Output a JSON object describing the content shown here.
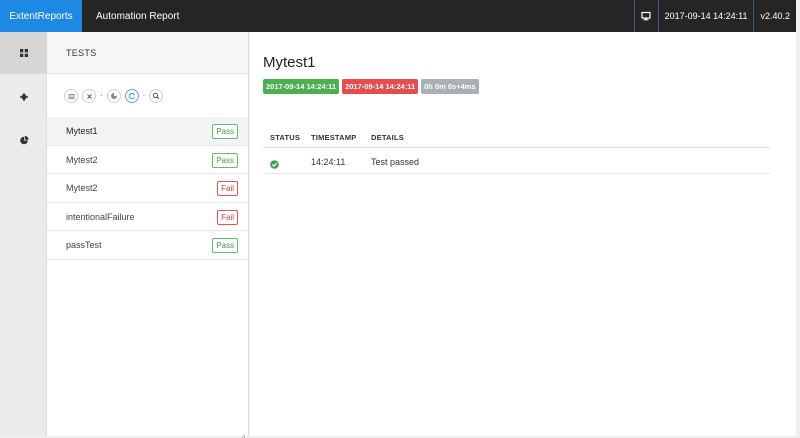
{
  "navbar": {
    "brand": "ExtentReports",
    "report_name": "Automation Report",
    "timestamp": "2017-09-14 14:24:11",
    "version": "v2.40.2",
    "brand_color": "#1e88e5"
  },
  "sidenav": {
    "items": [
      {
        "icon": "dashboard-grid-icon"
      },
      {
        "icon": "gear-icon"
      },
      {
        "icon": "pie-chart-icon"
      }
    ]
  },
  "tests_panel": {
    "header": "TESTS",
    "filters": [
      "filter-all-icon",
      "filter-fail-icon",
      "filter-skip-icon",
      "filter-refresh-icon",
      "filter-search-icon"
    ],
    "tests": [
      {
        "name": "Mytest1",
        "status": "Pass"
      },
      {
        "name": "Mytest2",
        "status": "Pass"
      },
      {
        "name": "Mytest2",
        "status": "Fail"
      },
      {
        "name": "intentionalFailure",
        "status": "Fail"
      },
      {
        "name": "passTest",
        "status": "Pass"
      }
    ]
  },
  "detail": {
    "title": "Mytest1",
    "start_time": "2017-09-14 14:24:11",
    "end_time": "2017-09-14 14:24:11",
    "duration": "0h 0m 0s+4ms",
    "columns": [
      "STATUS",
      "TIMESTAMP",
      "DETAILS"
    ],
    "logs": [
      {
        "status": "pass",
        "timestamp": "14:24:11",
        "details": "Test passed"
      }
    ]
  },
  "colors": {
    "pass": "#43a047",
    "fail": "#e53935",
    "neutral": "#a8b0b8"
  }
}
